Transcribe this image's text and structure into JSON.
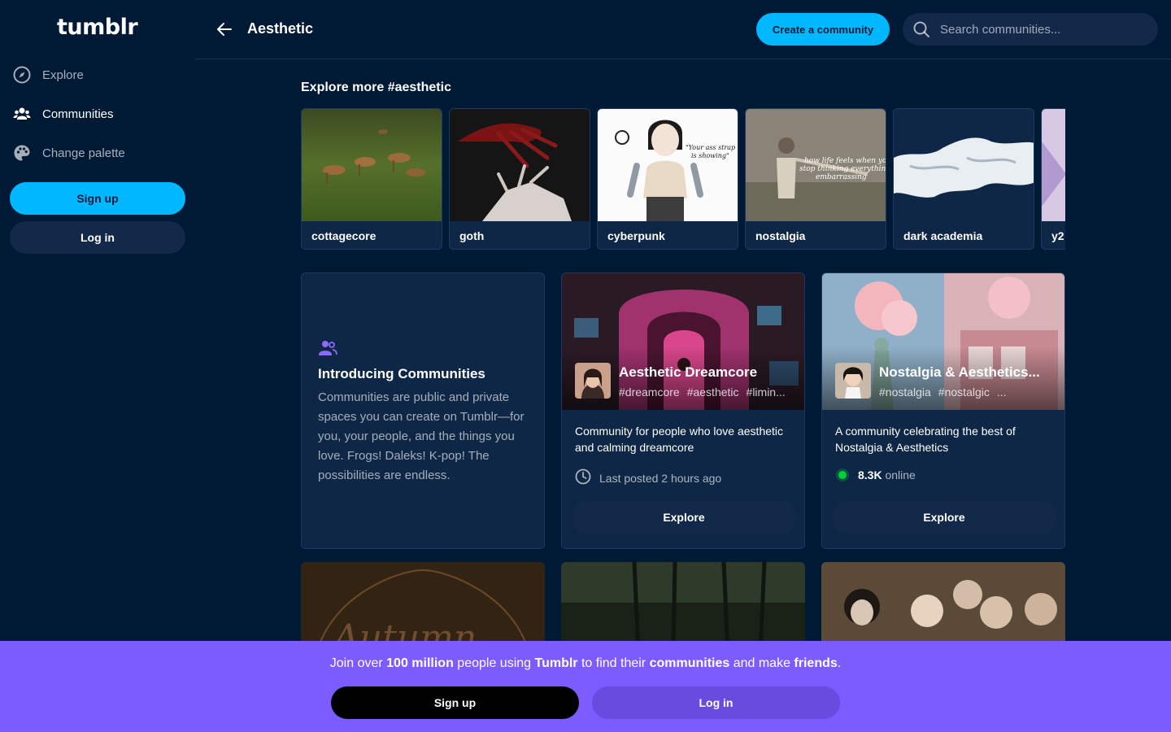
{
  "app": {
    "logo": "tumblr"
  },
  "sidebar": {
    "items": [
      {
        "label": "Explore",
        "icon": "compass-icon"
      },
      {
        "label": "Communities",
        "icon": "people-icon"
      },
      {
        "label": "Change palette",
        "icon": "palette-icon"
      }
    ],
    "signup_label": "Sign up",
    "login_label": "Log in"
  },
  "header": {
    "title": "Aesthetic",
    "create_label": "Create a community",
    "search_placeholder": "Search communities..."
  },
  "explore": {
    "title": "Explore more #aesthetic",
    "tags": [
      "cottagecore",
      "goth",
      "cyberpunk",
      "nostalgia",
      "dark academia",
      "y2"
    ]
  },
  "intro": {
    "title": "Introducing Communities",
    "body": "Communities are public and private spaces you can create on Tumblr—for you, your people, and the things you love. Frogs! Daleks! K-pop! The possibilities are endless."
  },
  "communities": [
    {
      "name": "Aesthetic Dreamcore",
      "tags": [
        "#dreamcore",
        "#aesthetic",
        "#limin..."
      ],
      "description": "Community for people who love aesthetic and calming dreamcore",
      "meta": "Last posted 2 hours ago",
      "explore_label": "Explore"
    },
    {
      "name": "Nostalgia & Aesthetics...",
      "tags": [
        "#nostalgia",
        "#nostalgic",
        "..."
      ],
      "description": "A community celebrating the best of Nostalgia & Aesthetics",
      "online_count": "8.3K",
      "online_label": "online",
      "explore_label": "Explore"
    }
  ],
  "banner": {
    "text_1": "Join over ",
    "bold_1": "100 million",
    "text_2": " people using ",
    "bold_2": "Tumblr",
    "text_3": " to find their ",
    "bold_3": "communities",
    "text_4": " and make ",
    "bold_4": "friends",
    "text_5": ".",
    "signup_label": "Sign up",
    "login_label": "Log in"
  },
  "colors": {
    "background": "#001935",
    "accent": "#00b8ff",
    "banner": "#7c5cff",
    "online": "#00cf35"
  }
}
